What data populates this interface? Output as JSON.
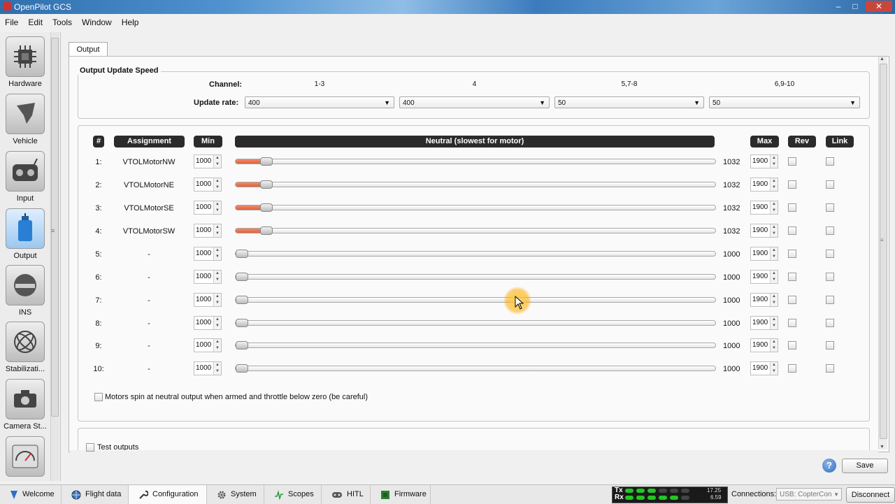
{
  "window": {
    "title": "OpenPilot GCS",
    "minimize": "–",
    "maximize": "□",
    "close": "✕"
  },
  "menu": [
    "File",
    "Edit",
    "Tools",
    "Window",
    "Help"
  ],
  "modes": [
    {
      "label": "Hardware",
      "icon": "chip-icon"
    },
    {
      "label": "Vehicle",
      "icon": "aircraft-icon"
    },
    {
      "label": "Input",
      "icon": "transmitter-icon"
    },
    {
      "label": "Output",
      "icon": "motor-icon",
      "active": true
    },
    {
      "label": "INS",
      "icon": "level-icon"
    },
    {
      "label": "Stabilizati...",
      "icon": "gyro-icon"
    },
    {
      "label": "Camera St...",
      "icon": "camera-icon"
    },
    {
      "label": "",
      "icon": "gauge-icon"
    }
  ],
  "tab": "Output",
  "update_speed": {
    "title": "Output Update Speed",
    "channel_label": "Channel:",
    "rate_label": "Update rate:",
    "channels": [
      "1-3",
      "4",
      "5,7-8",
      "6,9-10"
    ],
    "rates": [
      "400",
      "400",
      "50",
      "50"
    ]
  },
  "table": {
    "headers": {
      "num": "#",
      "assignment": "Assignment",
      "min": "Min",
      "neutral": "Neutral (slowest for motor)",
      "max": "Max",
      "rev": "Rev",
      "link": "Link"
    },
    "range_min": 1000,
    "range_max": 1900,
    "rows": [
      {
        "num": "1:",
        "assignment": "VTOLMotorNW",
        "min": "1000",
        "neutral": "1032",
        "max": "1900"
      },
      {
        "num": "2:",
        "assignment": "VTOLMotorNE",
        "min": "1000",
        "neutral": "1032",
        "max": "1900"
      },
      {
        "num": "3:",
        "assignment": "VTOLMotorSE",
        "min": "1000",
        "neutral": "1032",
        "max": "1900"
      },
      {
        "num": "4:",
        "assignment": "VTOLMotorSW",
        "min": "1000",
        "neutral": "1032",
        "max": "1900"
      },
      {
        "num": "5:",
        "assignment": "-",
        "min": "1000",
        "neutral": "1000",
        "max": "1900"
      },
      {
        "num": "6:",
        "assignment": "-",
        "min": "1000",
        "neutral": "1000",
        "max": "1900"
      },
      {
        "num": "7:",
        "assignment": "-",
        "min": "1000",
        "neutral": "1000",
        "max": "1900"
      },
      {
        "num": "8:",
        "assignment": "-",
        "min": "1000",
        "neutral": "1000",
        "max": "1900"
      },
      {
        "num": "9:",
        "assignment": "-",
        "min": "1000",
        "neutral": "1000",
        "max": "1900"
      },
      {
        "num": "10:",
        "assignment": "-",
        "min": "1000",
        "neutral": "1000",
        "max": "1900"
      }
    ]
  },
  "motors_spin_label": "Motors spin at neutral output when armed and throttle below zero (be careful)",
  "test_outputs_label": "Test outputs",
  "save_label": "Save",
  "help_symbol": "?",
  "bottom_tabs": [
    {
      "label": "Welcome",
      "icon": "welcome-icon"
    },
    {
      "label": "Flight data",
      "icon": "globe-icon"
    },
    {
      "label": "Configuration",
      "icon": "wrench-icon",
      "active": true
    },
    {
      "label": "System",
      "icon": "cog-icon"
    },
    {
      "label": "Scopes",
      "icon": "scope-icon"
    },
    {
      "label": "HITL",
      "icon": "gamepad-icon"
    },
    {
      "label": "Firmware",
      "icon": "board-icon"
    }
  ],
  "telemetry": {
    "tx_label": "Tx",
    "rx_label": "Rx",
    "tx_rate": "17.25",
    "rx_rate": "6.59"
  },
  "connections": {
    "label": "Connections:",
    "device": "USB: CopterCon",
    "disconnect_label": "Disconnect"
  },
  "colors": {
    "accent_fill": "#e0603c",
    "header_bg": "#2b2b2b",
    "tx_led": "#22cc22"
  }
}
